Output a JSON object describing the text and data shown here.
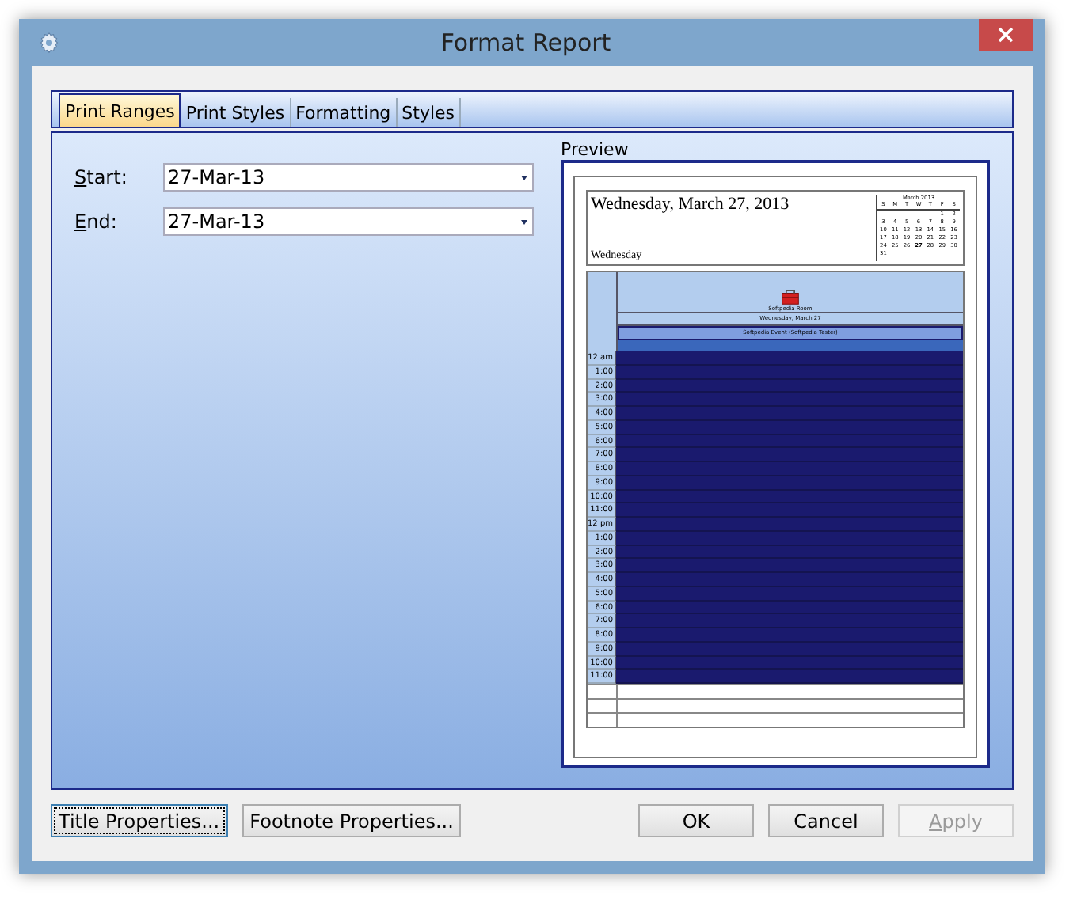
{
  "window": {
    "title": "Format Report"
  },
  "tabs": [
    {
      "label": "Print Ranges",
      "selected": true
    },
    {
      "label": "Print Styles",
      "selected": false
    },
    {
      "label": "Formatting",
      "selected": false
    },
    {
      "label": "Styles",
      "selected": false
    }
  ],
  "fields": [
    {
      "label": "Start:",
      "value": "27-Mar-13"
    },
    {
      "label": "End:",
      "value": "27-Mar-13"
    }
  ],
  "preview": {
    "label": "Preview",
    "title": "Wednesday, March 27, 2013",
    "day": "Wednesday",
    "calendar": {
      "month": "March 2013",
      "weekdays": [
        "S",
        "M",
        "T",
        "W",
        "T",
        "F",
        "S"
      ],
      "days": [
        "1",
        "2",
        "3",
        "4",
        "5",
        "6",
        "7",
        "8",
        "9",
        "10",
        "11",
        "12",
        "13",
        "14",
        "15",
        "16",
        "17",
        "18",
        "19",
        "20",
        "21",
        "22",
        "23",
        "24",
        "25",
        "26",
        "**27**",
        "28",
        "29",
        "30",
        "31"
      ]
    },
    "resource": "Softpedia Room",
    "date_header": "Wednesday, March 27",
    "event": "Softpedia Event (Softpedia Tester)",
    "times": [
      "12 am",
      "1:00",
      "2:00",
      "3:00",
      "4:00",
      "5:00",
      "6:00",
      "7:00",
      "8:00",
      "9:00",
      "10:00",
      "11:00",
      "12 pm",
      "1:00",
      "2:00",
      "3:00",
      "4:00",
      "5:00",
      "6:00",
      "7:00",
      "8:00",
      "9:00",
      "10:00",
      "11:00"
    ]
  },
  "buttons": [
    {
      "label": "Title Properties...",
      "focused": true,
      "disabled": false
    },
    {
      "label": "Footnote Properties...",
      "focused": false,
      "disabled": false
    },
    {
      "label": "OK",
      "focused": false,
      "disabled": false
    },
    {
      "label": "Cancel",
      "focused": false,
      "disabled": false
    },
    {
      "label": "Apply",
      "focused": false,
      "disabled": true
    }
  ]
}
